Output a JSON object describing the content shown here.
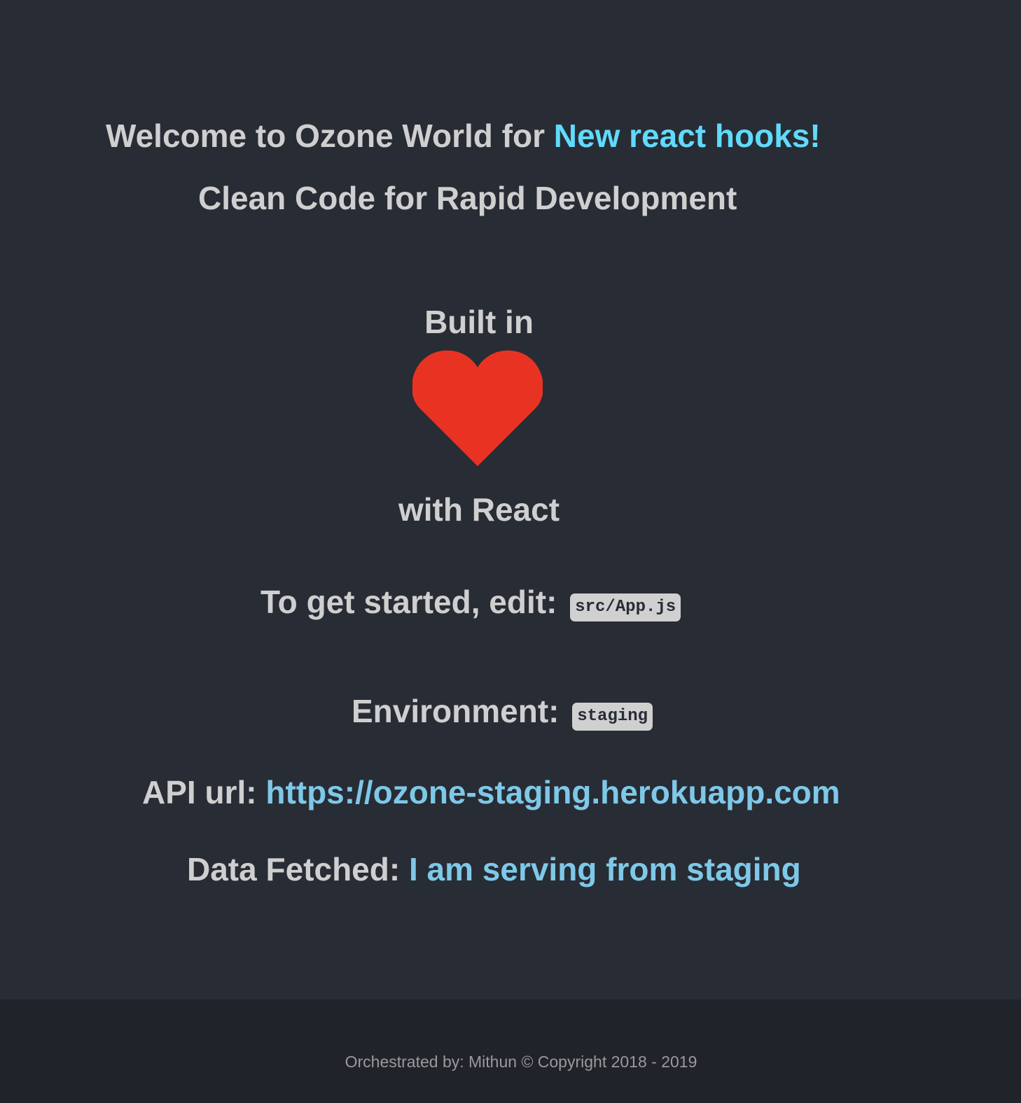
{
  "header": {
    "welcome_prefix": "Welcome to Ozone World for ",
    "welcome_accent": "New react hooks!",
    "tagline": "Clean Code for Rapid Development"
  },
  "built": {
    "prefix": "Built in",
    "icon": "heart-icon",
    "suffix": "with React"
  },
  "getting_started": {
    "label": "To get started, edit: ",
    "file": "src/App.js"
  },
  "environment": {
    "label": "Environment: ",
    "value": "staging"
  },
  "api": {
    "label": "API url: ",
    "url": "https://ozone-staging.herokuapp.com"
  },
  "data_fetched": {
    "label": "Data Fetched: ",
    "value": "I am serving from staging"
  },
  "footer": {
    "text": "Orchestrated by: Mithun © Copyright 2018 - 2019"
  },
  "colors": {
    "background": "#282c34",
    "footer_background": "#20232a",
    "text": "#cfcfcf",
    "accent": "#61dafb",
    "link": "#7ec8e8",
    "heart": "#e83323",
    "badge_background": "#d0d0d0"
  }
}
